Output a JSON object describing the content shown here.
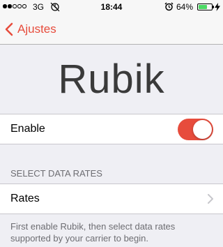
{
  "status_bar": {
    "carrier": "3G",
    "time": "18:44",
    "battery_percent": "64%",
    "battery_level": 0.64,
    "signal_bars_filled": 2,
    "signal_bars_total": 5
  },
  "nav": {
    "back_label": "Ajustes"
  },
  "page": {
    "title": "Rubik"
  },
  "enable_row": {
    "label": "Enable",
    "toggle_on": true
  },
  "rates_section": {
    "header": "SELECT DATA RATES",
    "row_label": "Rates",
    "footer": "First enable Rubik, then select data rates supported by your carrier to begin."
  },
  "colors": {
    "accent": "#e74c3c",
    "background": "#efeff4",
    "battery": "#4cd964"
  },
  "icons": {
    "back": "chevron-left-icon",
    "row_disclosure": "chevron-right-icon",
    "sync": "sync-icon",
    "alarm": "alarm-icon",
    "charging": "bolt-icon"
  }
}
